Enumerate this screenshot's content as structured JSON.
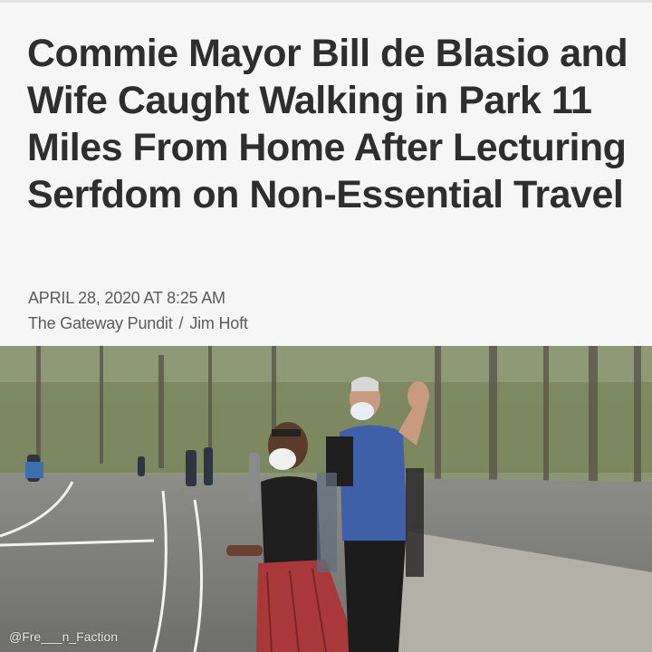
{
  "article": {
    "headline": "Commie Mayor Bill de Blasio and Wife Caught Walking in Park 11 Miles From Home After Lecturing Serfdom on Non-Essential Travel",
    "date": "APRIL 28, 2020 AT 8:25 AM",
    "source": "The Gateway Pundit",
    "separator": "/",
    "author": "Jim Hoft"
  },
  "photo": {
    "watermark": "@Fre___n_Faction"
  },
  "colors": {
    "headline": "#2e2e2e",
    "meta": "#5b5b5b",
    "background": "#f6f6f6"
  }
}
